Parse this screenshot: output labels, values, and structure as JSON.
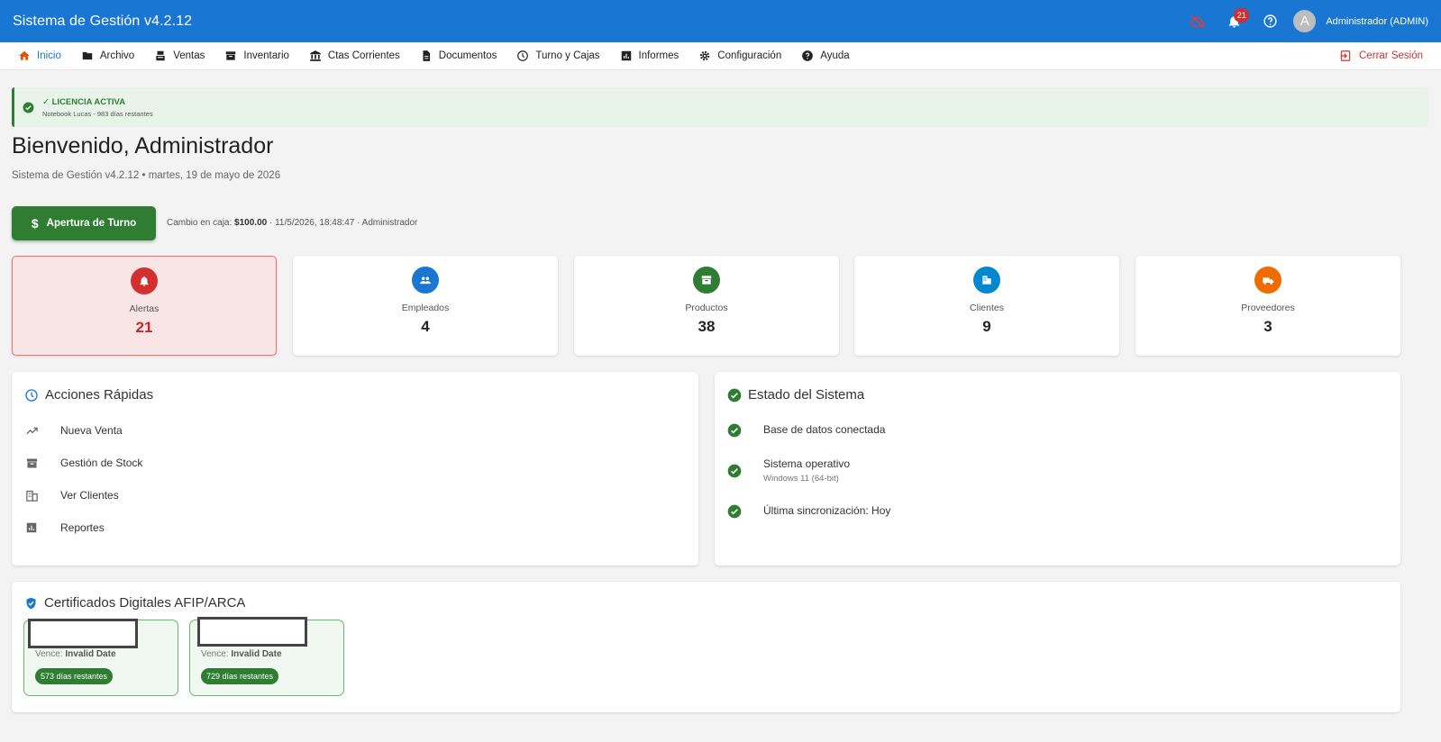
{
  "app": {
    "title": "Sistema de Gestión v4.2.12",
    "notifications_count": "21",
    "user_initial": "A",
    "user_name": "Administrador (ADMIN)"
  },
  "nav": {
    "items": [
      {
        "label": "Inicio",
        "icon": "home-icon"
      },
      {
        "label": "Archivo",
        "icon": "folder-icon"
      },
      {
        "label": "Ventas",
        "icon": "cash-register-icon"
      },
      {
        "label": "Inventario",
        "icon": "archive-icon"
      },
      {
        "label": "Ctas Corrientes",
        "icon": "bank-icon"
      },
      {
        "label": "Documentos",
        "icon": "document-icon"
      },
      {
        "label": "Turno y Cajas",
        "icon": "clock-icon"
      },
      {
        "label": "Informes",
        "icon": "bar-chart-icon"
      },
      {
        "label": "Configuración",
        "icon": "gear-icon"
      },
      {
        "label": "Ayuda",
        "icon": "help-icon"
      }
    ],
    "logout": "Cerrar Sesión"
  },
  "license": {
    "title": "✓ LICENCIA ACTIVA",
    "subtitle": "Notebook Lucas - 983 días restantes"
  },
  "welcome": {
    "heading": "Bienvenido, Administrador",
    "subtitle": "Sistema de Gestión v4.2.12 • martes, 19 de mayo de 2026"
  },
  "turno": {
    "button_label": "Apertura de Turno",
    "cambio_prefix": "Cambio en caja:",
    "cambio_amount": "$100.00",
    "cambio_suffix": "· 11/5/2026, 18:48:47 · Administrador"
  },
  "stats": [
    {
      "label": "Alertas",
      "value": "21",
      "color": "#d32f2f",
      "icon": "bell-icon"
    },
    {
      "label": "Empleados",
      "value": "4",
      "color": "#1976d2",
      "icon": "people-icon"
    },
    {
      "label": "Productos",
      "value": "38",
      "color": "#2e7d32",
      "icon": "archive-icon"
    },
    {
      "label": "Clientes",
      "value": "9",
      "color": "#0288d1",
      "icon": "building-icon"
    },
    {
      "label": "Proveedores",
      "value": "3",
      "color": "#ef6c00",
      "icon": "truck-icon"
    }
  ],
  "quick_actions": {
    "title": "Acciones Rápidas",
    "items": [
      {
        "label": "Nueva Venta",
        "icon": "trending-up-icon"
      },
      {
        "label": "Gestión de Stock",
        "icon": "archive-icon"
      },
      {
        "label": "Ver Clientes",
        "icon": "building-icon"
      },
      {
        "label": "Reportes",
        "icon": "bar-chart-icon"
      }
    ]
  },
  "system_status": {
    "title": "Estado del Sistema",
    "items": [
      {
        "label": "Base de datos conectada",
        "sub": ""
      },
      {
        "label": "Sistema operativo",
        "sub": "Windows 11 (64-bit)"
      },
      {
        "label": "Última sincronización: Hoy",
        "sub": ""
      }
    ]
  },
  "certificates": {
    "title": "Certificados Digitales AFIP/ARCA",
    "items": [
      {
        "vence_label": "Vence:",
        "vence_value": "Invalid Date",
        "remaining": "573 días restantes"
      },
      {
        "vence_label": "Vence:",
        "vence_value": "Invalid Date",
        "remaining": "729 días restantes"
      }
    ]
  },
  "colors": {
    "primary": "#1976d2",
    "success": "#2e7d32",
    "danger": "#d32f2f"
  }
}
